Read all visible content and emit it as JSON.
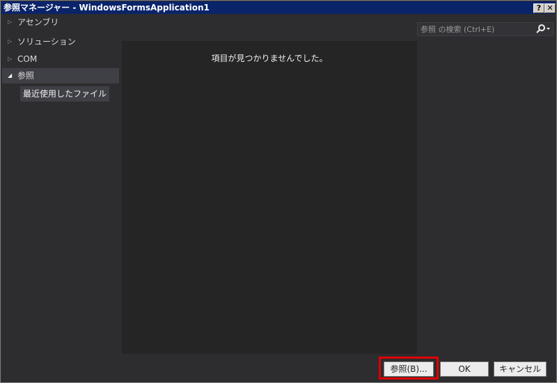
{
  "window": {
    "title": "参照マネージャー - WindowsFormsApplication1",
    "help_label": "?",
    "close_label": "✕"
  },
  "sidebar": {
    "items": [
      {
        "label": "アセンブリ",
        "arrow": "▷"
      },
      {
        "label": "ソリューション",
        "arrow": "▷"
      },
      {
        "label": "COM",
        "arrow": "▷"
      },
      {
        "label": "参照",
        "arrow": "◢"
      }
    ],
    "sub_items": [
      {
        "label": "最近使用したファイル"
      }
    ]
  },
  "main": {
    "empty_message": "項目が見つかりませんでした。"
  },
  "search": {
    "placeholder": "参照 の検索 (Ctrl+E)",
    "icon": "search-icon"
  },
  "footer": {
    "browse_label": "参照(B)...",
    "ok_label": "OK",
    "cancel_label": "キャンセル",
    "highlight_color": "#e00000"
  }
}
